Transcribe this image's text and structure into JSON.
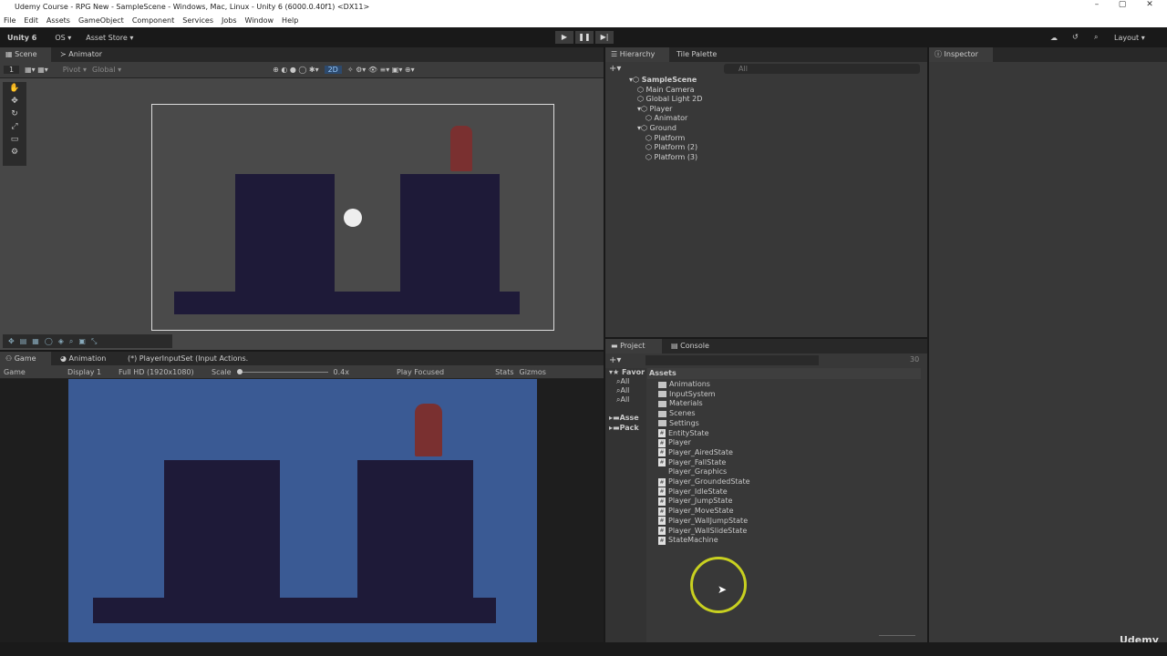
{
  "window": {
    "title": "Udemy Course - RPG New - SampleScene - Windows, Mac, Linux - Unity 6 (6000.0.40f1) <DX11>",
    "min": "–",
    "max": "▢",
    "close": "✕"
  },
  "menu": [
    "File",
    "Edit",
    "Assets",
    "GameObject",
    "Component",
    "Services",
    "Jobs",
    "Window",
    "Help"
  ],
  "toolbar": {
    "account": "Unity 6",
    "os": "OS ▾",
    "asset_store": "Asset Store ▾",
    "play": "▶",
    "pause": "❚❚",
    "step": "▶|",
    "layout": "Layout ▾"
  },
  "scene": {
    "tabs": [
      "Scene",
      "Animator"
    ],
    "layer": "1",
    "pivot": "Pivot ▾",
    "global": "Global ▾",
    "mode_2d": "2D"
  },
  "game": {
    "tabs": [
      "Game",
      "Animation",
      "(*) PlayerInputSet (Input Actions."
    ],
    "view": "Game",
    "display": "Display 1",
    "resolution": "Full HD (1920x1080)",
    "scale_label": "Scale",
    "scale_value": "0.4x",
    "play_mode": "Play Focused",
    "stats": "Stats",
    "gizmos": "Gizmos"
  },
  "hierarchy": {
    "tabs": [
      "Hierarchy",
      "Tile Palette"
    ],
    "search_placeholder": "All",
    "items": [
      {
        "label": "SampleScene",
        "depth": 0
      },
      {
        "label": "Main Camera",
        "depth": 1
      },
      {
        "label": "Global Light 2D",
        "depth": 1
      },
      {
        "label": "Player",
        "depth": 1
      },
      {
        "label": "Animator",
        "depth": 2
      },
      {
        "label": "Ground",
        "depth": 1
      },
      {
        "label": "Platform",
        "depth": 2
      },
      {
        "label": "Platform (2)",
        "depth": 2
      },
      {
        "label": "Platform (3)",
        "depth": 2
      }
    ]
  },
  "inspector": {
    "tab": "Inspector"
  },
  "project": {
    "tabs": [
      "Project",
      "Console"
    ],
    "count": "30",
    "favorites": "Favor",
    "fav_items": [
      "All",
      "All",
      "All"
    ],
    "roots": [
      "Asse",
      "Pack"
    ],
    "header": "Assets",
    "folders": [
      "Animations",
      "InputSystem",
      "Materials",
      "Scenes",
      "Settings"
    ],
    "files": [
      "EntityState",
      "Player",
      "Player_AiredState",
      "Player_FallState",
      "Player_Graphics",
      "Player_GroundedState",
      "Player_IdleState",
      "Player_JumpState",
      "Player_MoveState",
      "Player_WallJumpState",
      "Player_WallSlideState",
      "StateMachine"
    ]
  },
  "watermark": "Udemy",
  "colors": {
    "game_bg": "#3a5a94",
    "platform": "#1e1a38",
    "scene_bg": "#474747",
    "cursor_ring": "#c8d020"
  }
}
